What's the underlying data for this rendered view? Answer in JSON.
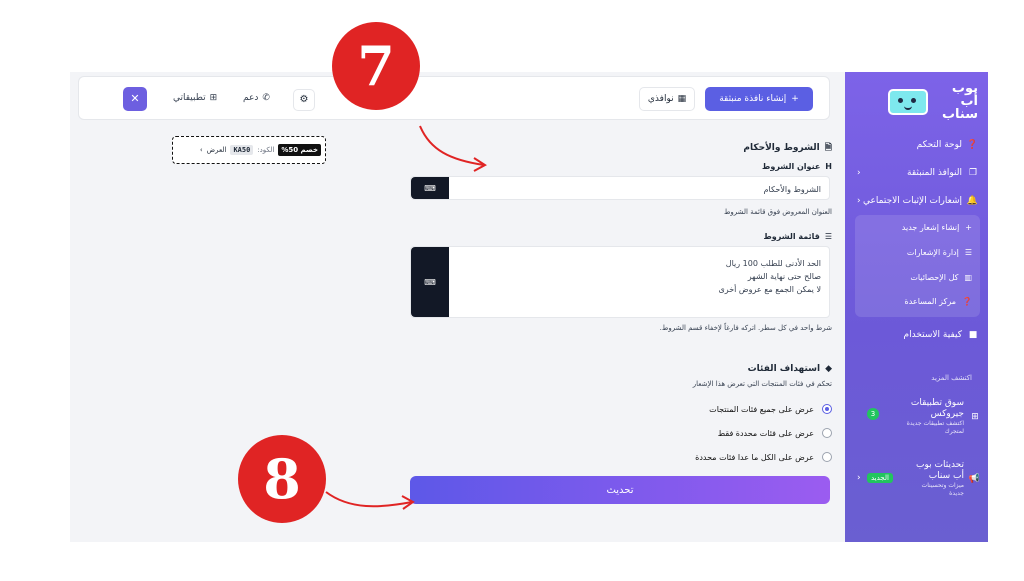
{
  "app": {
    "name": "بوب أب سناب"
  },
  "sidebar": {
    "items": [
      {
        "label": "لوحة التحكم",
        "icon": "help-circle-icon"
      },
      {
        "label": "النوافذ المنبثقة",
        "icon": "copy-icon"
      },
      {
        "label": "إشعارات الإثبات الاجتماعي",
        "icon": "bell-icon"
      }
    ],
    "submenu": [
      {
        "label": "إنشاء إشعار جديد",
        "icon": "plus-icon"
      },
      {
        "label": "إدارة الإشعارات",
        "icon": "list-icon"
      },
      {
        "label": "كل الإحصائيات",
        "icon": "bar-chart-icon"
      },
      {
        "label": "مركز المساعدة",
        "icon": "help-circle-icon"
      }
    ],
    "how_to": "كيفية الاستخدام",
    "discover": "اكتشف المزيد",
    "marketplace": {
      "title": "سوق تطبيقات جيروكس",
      "desc": "اكتشف تطبيقات جديدة لمتجرك",
      "badge": "3"
    },
    "updates": {
      "title": "تحديثات بوب أب سناب",
      "desc": "ميزات وتحسينات جديدة",
      "badge": "الجديد"
    }
  },
  "topbar": {
    "create_label": "إنشاء نافذة منبثقة",
    "windows_label": "نوافذي",
    "support_label": "دعم",
    "apps_label": "تطبيقاتي"
  },
  "offer": {
    "tag": "خصم 50%",
    "code_label": "الكود:",
    "code": "KA50",
    "view_label": "العرض"
  },
  "form": {
    "section_title": "الشروط والأحكام",
    "title_label": "عنوان الشروط",
    "title_value": "الشروط والأحكام",
    "title_help": "العنوان المعروض فوق قائمة الشروط",
    "list_label": "قائمة الشروط",
    "list_lines": [
      "الحد الأدنى للطلب 100 ريال",
      "صالح حتى نهاية الشهر",
      "لا يمكن الجمع مع عروض أخرى"
    ],
    "list_help": "شرط واحد في كل سطر. اتركه فارغاً لإخفاء قسم الشروط.",
    "targeting_title": "استهداف الفئات",
    "targeting_help": "تحكم في فئات المنتجات التي تعرض هذا الإشعار",
    "options": [
      "عرض على جميع فئات المنتجات",
      "عرض على فئات محددة فقط",
      "عرض على الكل ما عدا فئات محددة"
    ],
    "update_label": "تحديث"
  },
  "annotations": {
    "step_a": "7",
    "step_b": "8"
  },
  "colors": {
    "accent": "#5b5fe3",
    "sidebar": "#7d63e8",
    "annotation": "#e02424"
  }
}
